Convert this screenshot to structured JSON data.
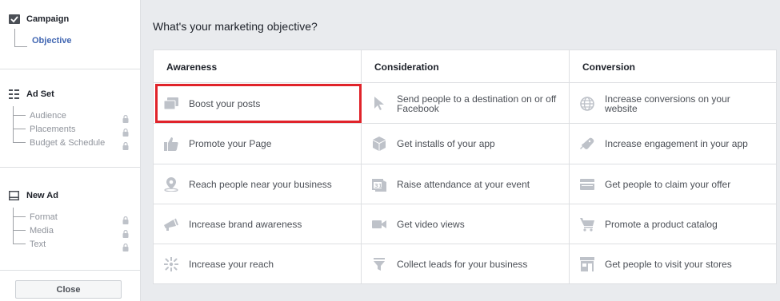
{
  "sidebar": {
    "campaign": {
      "label": "Campaign",
      "items": [
        {
          "label": "Objective",
          "active": true
        }
      ]
    },
    "adset": {
      "label": "Ad Set",
      "items": [
        {
          "label": "Audience"
        },
        {
          "label": "Placements"
        },
        {
          "label": "Budget & Schedule"
        }
      ]
    },
    "newad": {
      "label": "New Ad",
      "items": [
        {
          "label": "Format"
        },
        {
          "label": "Media"
        },
        {
          "label": "Text"
        }
      ]
    },
    "close_label": "Close"
  },
  "main": {
    "title": "What's your marketing objective?",
    "columns": [
      {
        "heading": "Awareness",
        "items": [
          {
            "label": "Boost your posts",
            "icon": "boost-posts-icon",
            "selected": true
          },
          {
            "label": "Promote your Page",
            "icon": "thumbs-up-icon"
          },
          {
            "label": "Reach people near your business",
            "icon": "location-pin-icon"
          },
          {
            "label": "Increase brand awareness",
            "icon": "megaphone-icon"
          },
          {
            "label": "Increase your reach",
            "icon": "reach-icon"
          }
        ]
      },
      {
        "heading": "Consideration",
        "items": [
          {
            "label": "Send people to a destination on or off Facebook",
            "icon": "cursor-icon"
          },
          {
            "label": "Get installs of your app",
            "icon": "box-icon"
          },
          {
            "label": "Raise attendance at your event",
            "icon": "calendar-icon"
          },
          {
            "label": "Get video views",
            "icon": "video-camera-icon"
          },
          {
            "label": "Collect leads for your business",
            "icon": "funnel-icon"
          }
        ]
      },
      {
        "heading": "Conversion",
        "items": [
          {
            "label": "Increase conversions on your website",
            "icon": "globe-icon"
          },
          {
            "label": "Increase engagement in your app",
            "icon": "gamepad-icon"
          },
          {
            "label": "Get people to claim your offer",
            "icon": "ticket-icon"
          },
          {
            "label": "Promote a product catalog",
            "icon": "shopping-cart-icon"
          },
          {
            "label": "Get people to visit your stores",
            "icon": "store-icon"
          }
        ]
      }
    ]
  },
  "colors": {
    "accent": "#4267b2",
    "selected_border": "#e0232a",
    "icon_gray": "#bec2c9"
  }
}
